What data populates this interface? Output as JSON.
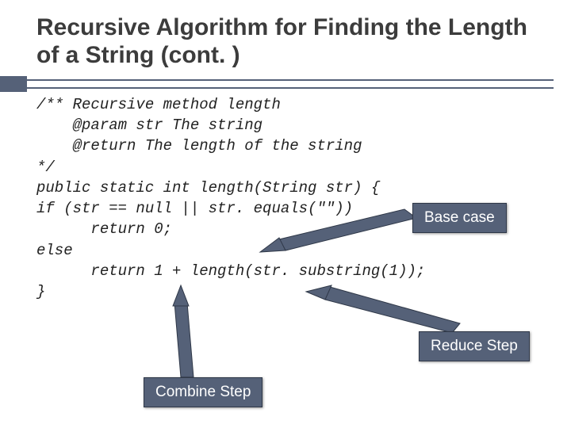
{
  "title": "Recursive Algorithm for Finding the Length of a String (cont. )",
  "code": {
    "l0": "/** Recursive method length",
    "l1": "    @param str The string",
    "l2": "    @return The length of the string",
    "l3": "*/",
    "l4": "public static int length(String str) {",
    "l5": "if (str == null || str. equals(\"\"))",
    "l6": "      return 0;",
    "l7": "else",
    "l8": "      return 1 + length(str. substring(1));",
    "l9": "}"
  },
  "labels": {
    "base": "Base case",
    "reduce": "Reduce Step",
    "combine": "Combine Step"
  }
}
